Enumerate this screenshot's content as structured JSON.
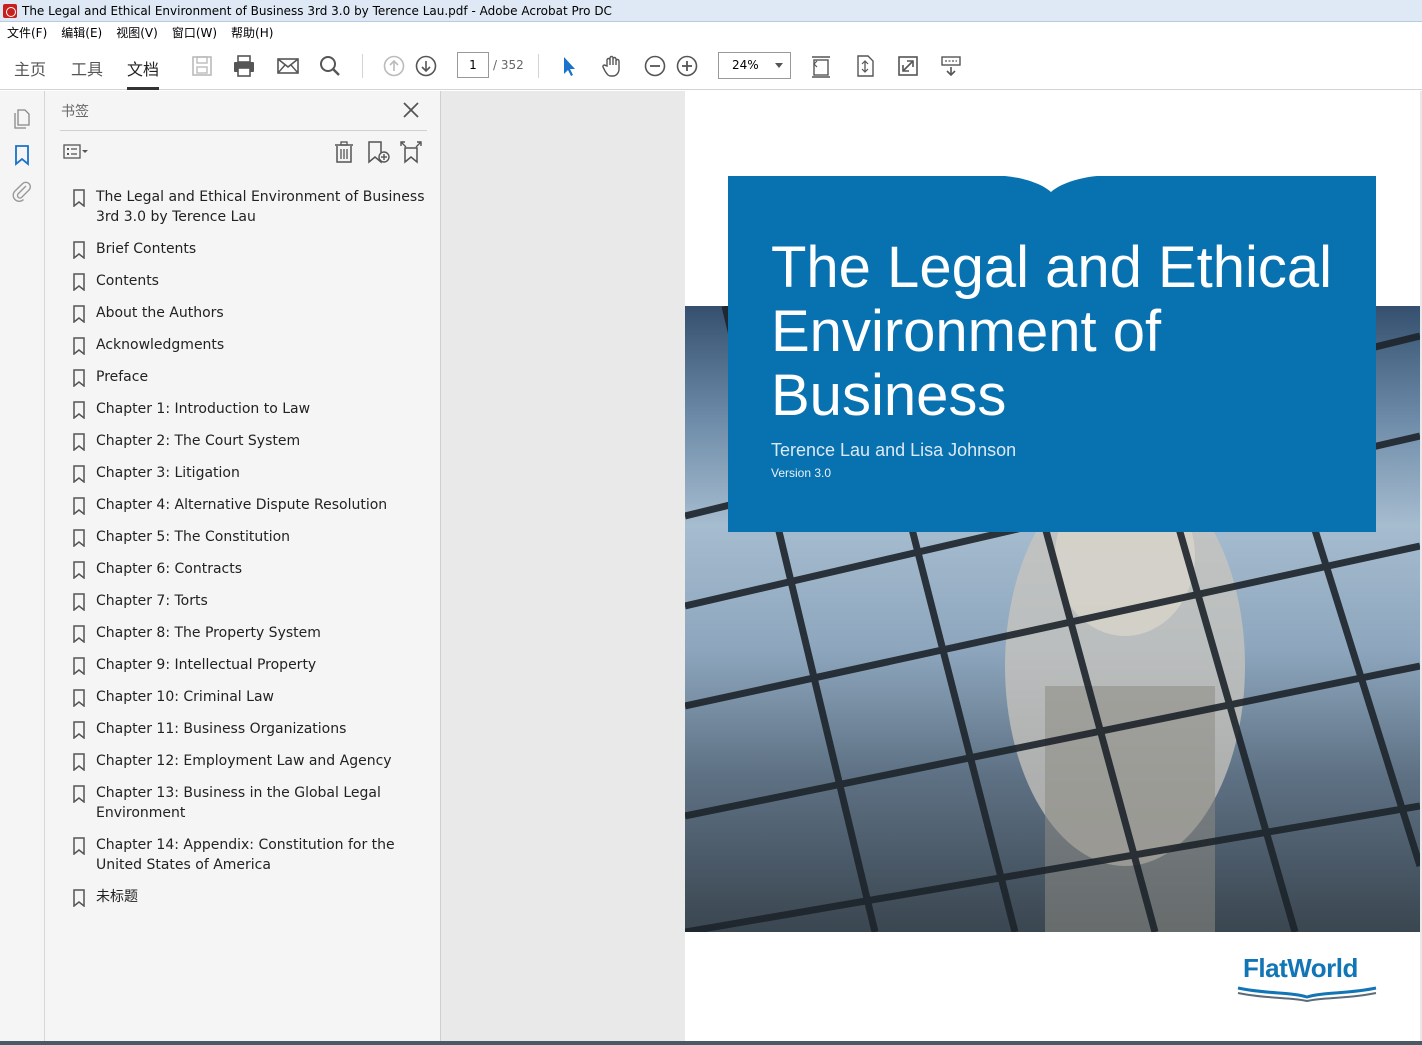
{
  "window": {
    "title": "The Legal and Ethical Environment of Business 3rd 3.0 by Terence Lau.pdf - Adobe Acrobat Pro DC"
  },
  "menu": [
    "文件(F)",
    "编辑(E)",
    "视图(V)",
    "窗口(W)",
    "帮助(H)"
  ],
  "tabs": {
    "home": "主页",
    "tools": "工具",
    "document": "文档"
  },
  "toolbar": {
    "current_page": "1",
    "total_pages": "/ 352",
    "zoom": "24%"
  },
  "bookmarks_panel": {
    "title": "书签",
    "items": [
      "The Legal and Ethical Environment of Business 3rd 3.0 by Terence Lau",
      "Brief Contents",
      "Contents",
      "About the Authors",
      "Acknowledgments",
      "Preface",
      "Chapter 1: Introduction to Law",
      "Chapter 2: The Court System",
      "Chapter 3: Litigation",
      "Chapter 4: Alternative Dispute Resolution",
      "Chapter 5: The Constitution",
      "Chapter 6: Contracts",
      "Chapter 7: Torts",
      "Chapter 8: The Property System",
      "Chapter 9: Intellectual Property",
      "Chapter 10: Criminal Law",
      "Chapter 11: Business Organizations",
      "Chapter 12: Employment Law and Agency",
      "Chapter 13: Business in the Global Legal Environment",
      "Chapter 14: Appendix: Constitution for the United States of America",
      "未标题"
    ]
  },
  "cover": {
    "title": "The Legal and Ethical Environment of Business",
    "authors": "Terence Lau and Lisa Johnson",
    "version": "Version 3.0",
    "publisher_logo": "FlatWorld",
    "brand_color": "#0872b0"
  }
}
